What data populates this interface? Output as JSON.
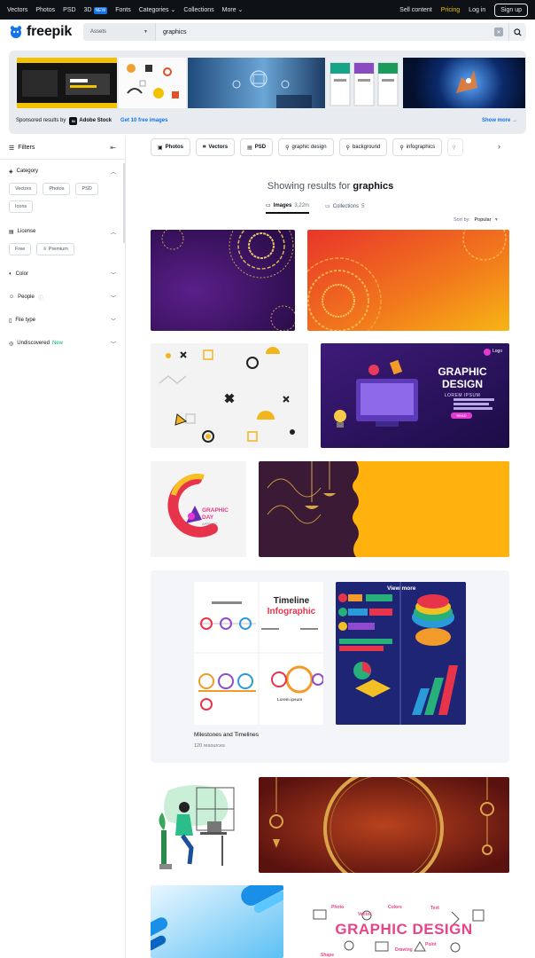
{
  "topnav": {
    "left": [
      "Vectors",
      "Photos",
      "PSD",
      "3D",
      "Fonts",
      "Categories",
      "Collections",
      "More"
    ],
    "badge": "NEW",
    "sell": "Sell content",
    "pricing": "Pricing",
    "login": "Log in",
    "signup": "Sign up"
  },
  "header": {
    "logo": "freepik",
    "asset_select": "Assets",
    "search_value": "graphics"
  },
  "sponsored": {
    "label": "Sponsored results by",
    "brand": "Adobe Stock",
    "brand_mark": "St",
    "free_link": "Get 10 free images",
    "show_more": "Show more"
  },
  "filters": {
    "title": "Filters",
    "category": {
      "title": "Category",
      "chips": [
        "Vectors",
        "Photos",
        "PSD",
        "Icons"
      ]
    },
    "license": {
      "title": "License",
      "chips": [
        "Free",
        "Premium"
      ]
    },
    "color": "Color",
    "people": "People",
    "file_type": "File type",
    "undiscovered": "Undiscovered",
    "undiscovered_tag": "New"
  },
  "quicktags": [
    "Photos",
    "Vectors",
    "PSD",
    "graphic design",
    "background",
    "infographics"
  ],
  "results": {
    "prefix": "Showing results for",
    "query": "graphics",
    "tab_images": "Images",
    "tab_images_count": "3,22m",
    "tab_collections": "Collections",
    "tab_collections_count": "5",
    "sort_label": "Sort by:",
    "sort_value": "Popular"
  },
  "cards": {
    "graphic_design": {
      "title": "GRAPHIC DESIGN",
      "sub": "LOREM IPSUM",
      "btn": "READ",
      "logo": "Logo"
    },
    "graphic_day": {
      "title": "GRAPHIC DAY",
      "sub": "APRIL 27"
    },
    "timeline": {
      "title": "Timeline",
      "sub": "Infographic",
      "note": "Lorem ipsum"
    },
    "word_cloud": {
      "title": "GRAPHIC DESIGN",
      "words": [
        "Photo",
        "Colors",
        "Text",
        "Vector",
        "Drawing",
        "Point",
        "Shape"
      ]
    }
  },
  "collection": {
    "title": "Milestones and Timelines",
    "count": "120 resources",
    "view_more": "View more"
  },
  "colors": {
    "accent": "#1273eb",
    "pricing": "#f3c400",
    "nav_bg": "#0e1217"
  }
}
